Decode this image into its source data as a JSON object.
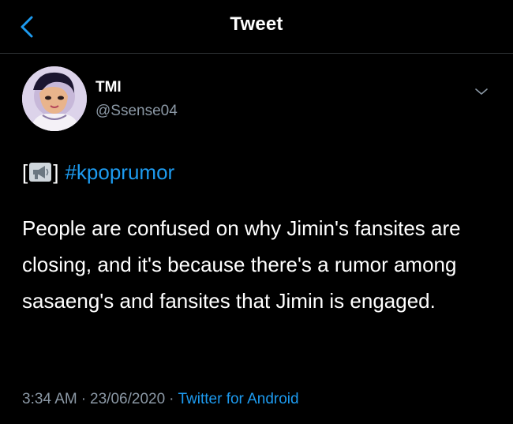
{
  "header": {
    "title": "Tweet"
  },
  "author": {
    "name": "TMI",
    "handle": "@Ssense04"
  },
  "tweet": {
    "bracket_open": "[",
    "bracket_close": "]",
    "icon": "megaphone-icon",
    "hashtag": "#kpoprumor",
    "text": "People are confused on why Jimin's fansites are closing, and it's because there's a rumor among sasaeng's and fansites that Jimin is engaged."
  },
  "meta": {
    "time": "3:34 AM",
    "separator": "·",
    "date": "23/06/2020",
    "separator2": "·",
    "source": "Twitter for Android"
  },
  "colors": {
    "background": "#000000",
    "accent": "#1d9bf0",
    "secondary_text": "#8b98a5",
    "divider": "#2f3336"
  }
}
